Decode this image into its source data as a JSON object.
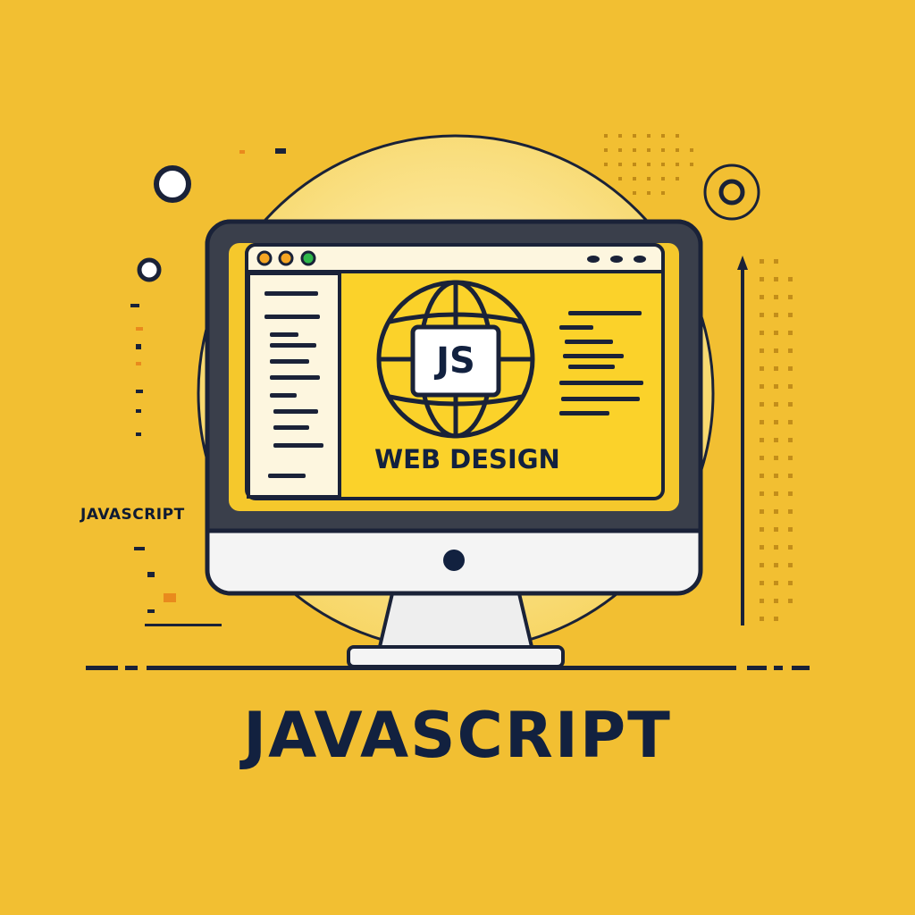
{
  "side_label": "JAVASCRIPT",
  "title": "JAVASCRIPT",
  "screen": {
    "badge_text": "JS",
    "caption": "WEB DESIGN"
  },
  "browser": {
    "window_dots": [
      "#f5a623",
      "#f5a623",
      "#2fb84a"
    ],
    "menu_dots_icon": "ellipsis-icon"
  },
  "icons": [
    "globe-icon",
    "code-lines-icon",
    "monitor-icon",
    "target-icon",
    "arrow-up-icon"
  ],
  "colors": {
    "background": "#f2bf32",
    "screen_yellow": "#fbd22a",
    "ink": "#12213f",
    "frame": "#3a3f4b",
    "bezel": "#f4f4f4"
  }
}
